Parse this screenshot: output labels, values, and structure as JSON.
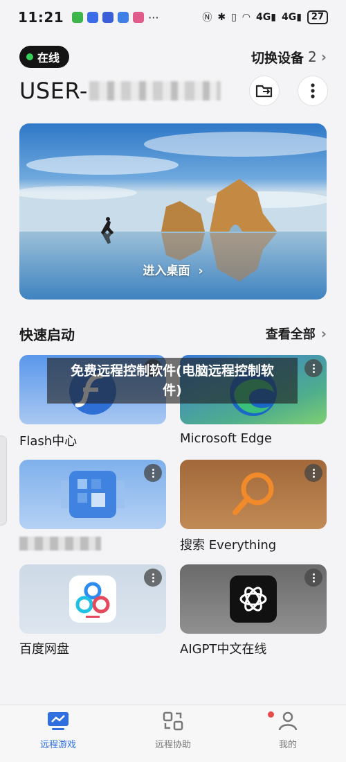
{
  "status_bar": {
    "time": "11:21",
    "battery": "27",
    "signal_a": "4G",
    "signal_b": "4G"
  },
  "header": {
    "online_label": "在线",
    "switch_device_label": "切换设备",
    "device_count": "2",
    "username": "USER-"
  },
  "banner": {
    "cta": "进入桌面"
  },
  "quick_launch": {
    "title": "快速启动",
    "see_all": "查看全部",
    "apps": [
      {
        "label": "Flash中心",
        "icon": "flash-icon"
      },
      {
        "label": "Microsoft Edge",
        "icon": "edge-icon"
      },
      {
        "label": "",
        "icon": "pixelated-app-icon"
      },
      {
        "label": "搜索 Everything",
        "icon": "magnifier-icon"
      },
      {
        "label": "百度网盘",
        "icon": "baidu-netdisk-icon"
      },
      {
        "label": "AIGPT中文在线",
        "icon": "openai-icon"
      }
    ]
  },
  "watermark": {
    "line1": "免费远程控制软件(电脑远程控制软",
    "line2": "件)"
  },
  "tabbar": {
    "tabs": [
      {
        "label": "远程游戏",
        "icon": "monitor-chart-icon",
        "active": true
      },
      {
        "label": "远程协助",
        "icon": "remote-assist-icon",
        "active": false
      },
      {
        "label": "我的",
        "icon": "person-icon",
        "active": false
      }
    ]
  },
  "colors": {
    "accent": "#2f6fe0",
    "online": "#34d058",
    "notification": "#e94a4a"
  }
}
